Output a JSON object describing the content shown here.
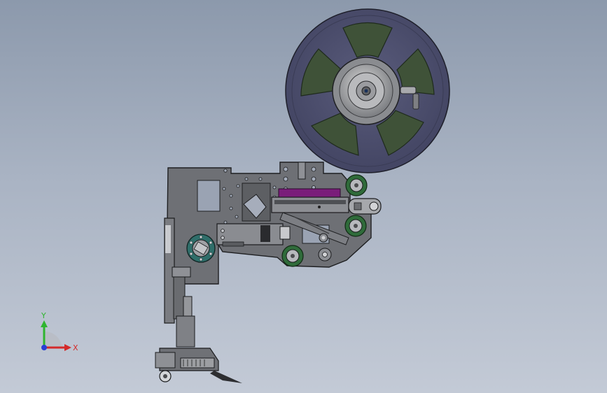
{
  "axes": {
    "y_label": "Y",
    "x_label": "X",
    "y_color": "#2fb52f",
    "x_color": "#d42a2a",
    "z_color": "#2a3fd4"
  },
  "colors": {
    "background_top": "#8c99ac",
    "background_bottom": "#c3cad6",
    "plate": "#6d6f73",
    "plate_dark": "#4a4c50",
    "reel_rim": "#4c4e6e",
    "reel_window": "#3f5238",
    "roller_green": "#2f6b3a",
    "accent_purple": "#7a1d7a",
    "hub_teal": "#2f6e6a"
  },
  "components": {
    "reel": "tape-reel",
    "frame": "main-frame-plate",
    "rollers": "guide-rollers",
    "feeder": "label-feeder-head"
  }
}
